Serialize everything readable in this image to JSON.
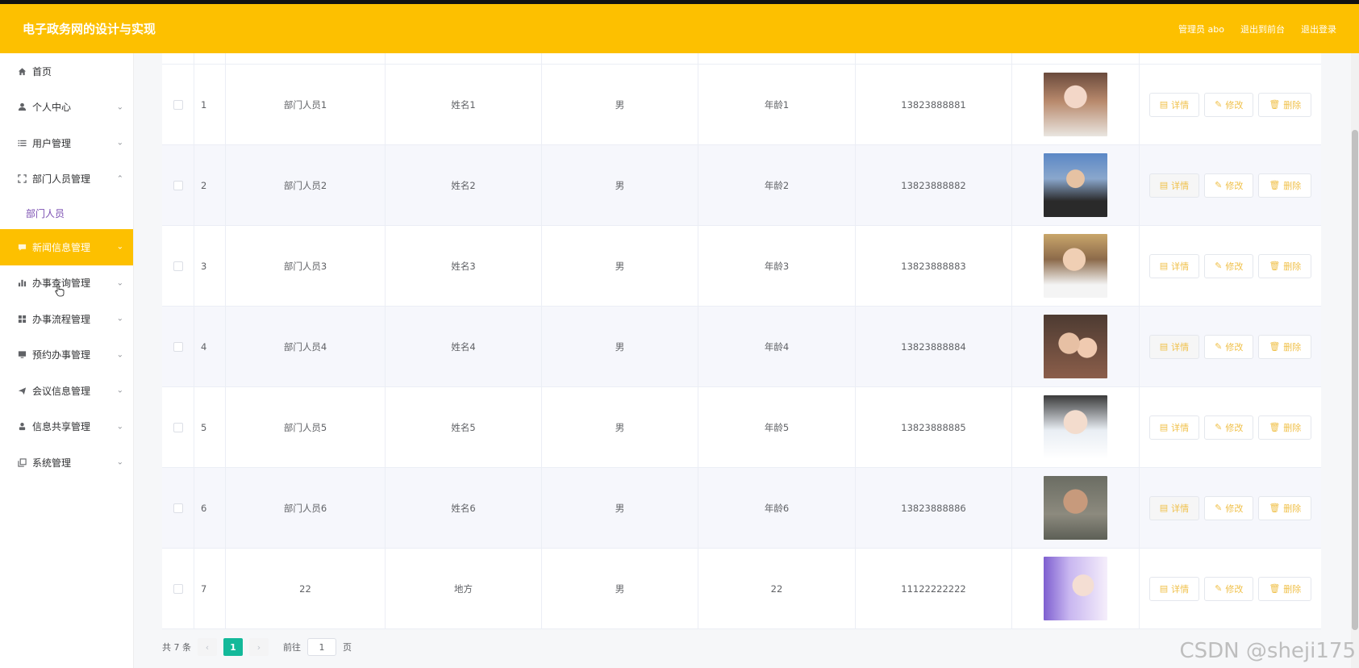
{
  "header": {
    "title": "电子政务网的设计与实现",
    "user_label": "管理员 abo",
    "back_label": "退出到前台",
    "logout_label": "退出登录"
  },
  "sidebar": {
    "items": [
      {
        "label": "首页",
        "icon": "home-icon"
      },
      {
        "label": "个人中心",
        "icon": "user-icon"
      },
      {
        "label": "用户管理",
        "icon": "list-icon"
      },
      {
        "label": "部门人员管理",
        "icon": "fullscreen-icon"
      },
      {
        "label": "新闻信息管理",
        "icon": "chat-icon"
      },
      {
        "label": "办事查询管理",
        "icon": "chart-icon"
      },
      {
        "label": "办事流程管理",
        "icon": "grid-icon"
      },
      {
        "label": "预约办事管理",
        "icon": "monitor-icon"
      },
      {
        "label": "会议信息管理",
        "icon": "send-icon"
      },
      {
        "label": "信息共享管理",
        "icon": "person-icon"
      },
      {
        "label": "系统管理",
        "icon": "copy-icon"
      }
    ],
    "subitem": "部门人员",
    "accent": "#fdc000"
  },
  "table": {
    "rows": [
      {
        "idx": "1",
        "dept": "部门人员1",
        "name": "姓名1",
        "gender": "男",
        "age": "年龄1",
        "phone": "13823888881"
      },
      {
        "idx": "2",
        "dept": "部门人员2",
        "name": "姓名2",
        "gender": "男",
        "age": "年龄2",
        "phone": "13823888882"
      },
      {
        "idx": "3",
        "dept": "部门人员3",
        "name": "姓名3",
        "gender": "男",
        "age": "年龄3",
        "phone": "13823888883"
      },
      {
        "idx": "4",
        "dept": "部门人员4",
        "name": "姓名4",
        "gender": "男",
        "age": "年龄4",
        "phone": "13823888884"
      },
      {
        "idx": "5",
        "dept": "部门人员5",
        "name": "姓名5",
        "gender": "男",
        "age": "年龄5",
        "phone": "13823888885"
      },
      {
        "idx": "6",
        "dept": "部门人员6",
        "name": "姓名6",
        "gender": "男",
        "age": "年龄6",
        "phone": "13823888886"
      },
      {
        "idx": "7",
        "dept": "22",
        "name": "地方",
        "gender": "男",
        "age": "22",
        "phone": "11122222222"
      }
    ],
    "buttons": {
      "detail": "详情",
      "edit": "修改",
      "delete": "删除"
    }
  },
  "pagination": {
    "total": "共 7 条",
    "current": "1",
    "goto_prefix": "前往",
    "goto_value": "1",
    "goto_suffix": "页"
  },
  "watermark": "CSDN @sheji175"
}
